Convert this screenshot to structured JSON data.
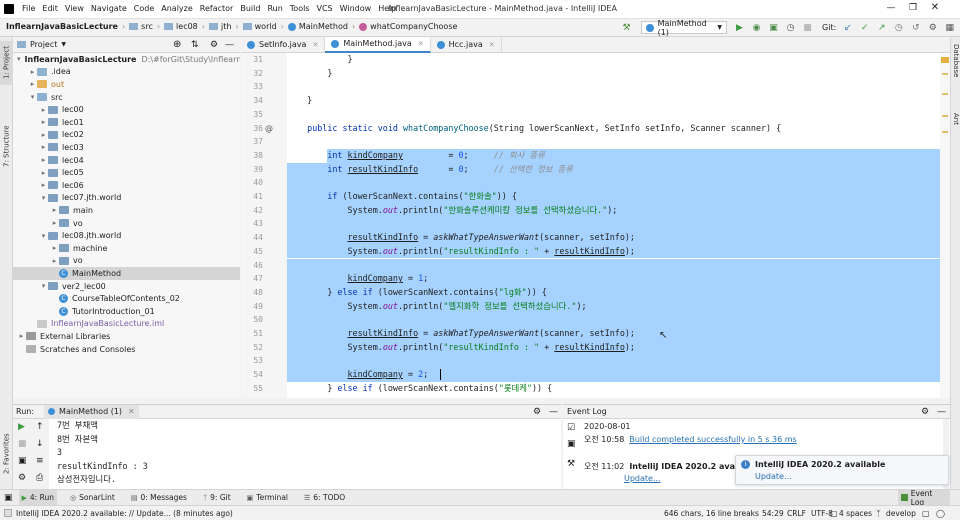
{
  "window": {
    "title": "InflearnJavaBasicLecture - MainMethod.java - IntelliJ IDEA",
    "menu": [
      "File",
      "Edit",
      "View",
      "Navigate",
      "Code",
      "Analyze",
      "Refactor",
      "Build",
      "Run",
      "Tools",
      "VCS",
      "Window",
      "Help"
    ]
  },
  "breadcrumb": [
    "InflearnJavaBasicLecture",
    "src",
    "lec08",
    "jth",
    "world",
    "MainMethod",
    "whatCompanyChoose"
  ],
  "toolbar": {
    "run_config": "MainMethod (1)",
    "git_label": "Git:"
  },
  "left_strip": {
    "project": "1: Project",
    "structure": "7: Structure",
    "favorites": "2: Favorites"
  },
  "right_strip": {
    "database": "Database",
    "ant": "Ant"
  },
  "project_panel": {
    "title": "Project",
    "tree": [
      {
        "label": "InflearnJavaBasicLecture",
        "path": "D:\\#forGit\\Study\\InflearnJavaBa",
        "depth": 0,
        "icon": "folder",
        "open": true,
        "bold": true
      },
      {
        "label": ".idea",
        "depth": 1,
        "icon": "folder",
        "open": false
      },
      {
        "label": "out",
        "depth": 1,
        "icon": "folder-orange",
        "open": false
      },
      {
        "label": "src",
        "depth": 1,
        "icon": "folder",
        "open": true
      },
      {
        "label": "lec00",
        "depth": 2,
        "icon": "package",
        "open": false
      },
      {
        "label": "lec01",
        "depth": 2,
        "icon": "package",
        "open": false
      },
      {
        "label": "lec02",
        "depth": 2,
        "icon": "package",
        "open": false
      },
      {
        "label": "lec03",
        "depth": 2,
        "icon": "package",
        "open": false
      },
      {
        "label": "lec04",
        "depth": 2,
        "icon": "package",
        "open": false
      },
      {
        "label": "lec05",
        "depth": 2,
        "icon": "package",
        "open": false
      },
      {
        "label": "lec06",
        "depth": 2,
        "icon": "package",
        "open": false
      },
      {
        "label": "lec07.jth.world",
        "depth": 2,
        "icon": "package",
        "open": true
      },
      {
        "label": "main",
        "depth": 3,
        "icon": "package",
        "open": false
      },
      {
        "label": "vo",
        "depth": 3,
        "icon": "package",
        "open": false
      },
      {
        "label": "lec08.jth.world",
        "depth": 2,
        "icon": "package",
        "open": true
      },
      {
        "label": "machine",
        "depth": 3,
        "icon": "package",
        "open": false
      },
      {
        "label": "vo",
        "depth": 3,
        "icon": "package",
        "open": false
      },
      {
        "label": "MainMethod",
        "depth": 3,
        "icon": "java",
        "leaf": true,
        "selected": true
      },
      {
        "label": "ver2_lec00",
        "depth": 2,
        "icon": "package",
        "open": true
      },
      {
        "label": "CourseTableOfContents_02",
        "depth": 3,
        "icon": "java",
        "leaf": true
      },
      {
        "label": "TutorIntroduction_01",
        "depth": 3,
        "icon": "java",
        "leaf": true
      },
      {
        "label": "InflearnJavaBasicLecture.iml",
        "depth": 1,
        "icon": "iml",
        "leaf": true
      },
      {
        "label": "External Libraries",
        "depth": 0,
        "icon": "lib",
        "open": false
      },
      {
        "label": "Scratches and Consoles",
        "depth": 0,
        "icon": "scratch",
        "leaf": true
      }
    ]
  },
  "editor": {
    "tabs": [
      {
        "label": "SetInfo.java",
        "active": false
      },
      {
        "label": "MainMethod.java",
        "active": true
      },
      {
        "label": "Hcc.java",
        "active": false
      }
    ],
    "lines": [
      {
        "n": "31",
        "sel": false,
        "html": "            }"
      },
      {
        "n": "32",
        "sel": false,
        "html": "        }"
      },
      {
        "n": "33",
        "sel": false,
        "html": ""
      },
      {
        "n": "34",
        "sel": false,
        "html": "    }"
      },
      {
        "n": "35",
        "sel": false,
        "html": ""
      },
      {
        "n": "36",
        "sel": false,
        "html": "    <span class=\"kw\">public static void</span> <span class=\"fn\">whatCompanyChoose</span>(String lowerScanNext, SetInfo setInfo, Scanner scanner) {"
      },
      {
        "n": "37",
        "sel": false,
        "html": ""
      },
      {
        "n": "38",
        "sel": "partial",
        "html": "        <span class=\"kw\">int</span> <span class=\"ul\">kindCompany</span>         = <span class=\"num\">0</span>;     <span class=\"cmt\">// 회사 종류</span>"
      },
      {
        "n": "39",
        "sel": true,
        "html": "        <span class=\"kw\">int</span> <span class=\"ul\">resultKindInfo</span>      = <span class=\"num\">0</span>;     <span class=\"cmt\">// 선택한 정보 종류</span>"
      },
      {
        "n": "40",
        "sel": true,
        "html": ""
      },
      {
        "n": "41",
        "sel": true,
        "html": "        <span class=\"kw\">if</span> (lowerScanNext.contains(<span class=\"str\">\"한화솔\"</span>)) {"
      },
      {
        "n": "42",
        "sel": true,
        "html": "            System.<span class=\"st\">out</span>.println(<span class=\"str\">\"한화솔루션케미칼 정보를 선택하셨습니다.\"</span>);"
      },
      {
        "n": "43",
        "sel": true,
        "html": ""
      },
      {
        "n": "44",
        "sel": true,
        "html": "            <span class=\"ul\">resultKindInfo</span> = <span class=\"mf\">askWhatTypeAnswerWant</span>(scanner, setInfo);"
      },
      {
        "n": "45",
        "sel": true,
        "html": "            System.<span class=\"st\">out</span>.println(<span class=\"str\">\"resultKindInfo : \"</span> + <span class=\"ul\">resultKindInfo</span>);"
      },
      {
        "n": "46",
        "sel": true,
        "html": ""
      },
      {
        "n": "47",
        "sel": true,
        "html": "            <span class=\"ul\">kindCompany</span> = <span class=\"num\">1</span>;"
      },
      {
        "n": "48",
        "sel": true,
        "html": "        } <span class=\"kw\">else if</span> (lowerScanNext.contains(<span class=\"str\">\"lg화\"</span>)) {"
      },
      {
        "n": "49",
        "sel": true,
        "html": "            System.<span class=\"st\">out</span>.println(<span class=\"str\">\"엘지화학 정보를 선택하셨습니다.\"</span>);"
      },
      {
        "n": "50",
        "sel": true,
        "html": ""
      },
      {
        "n": "51",
        "sel": true,
        "html": "            <span class=\"ul\">resultKindInfo</span> = <span class=\"mf\">askWhatTypeAnswerWant</span>(scanner, setInfo);"
      },
      {
        "n": "52",
        "sel": true,
        "html": "            System.<span class=\"st\">out</span>.println(<span class=\"str\">\"resultKindInfo : \"</span> + <span class=\"ul\">resultKindInfo</span>);"
      },
      {
        "n": "53",
        "sel": true,
        "html": ""
      },
      {
        "n": "54",
        "sel": true,
        "html": "            <span class=\"ul\">kindCompany</span> = <span class=\"num\">2</span>;"
      },
      {
        "n": "55",
        "sel": false,
        "html": "        } <span class=\"kw\">else if</span> (lowerScanNext.contains(<span class=\"str\">\"롯데케\"</span>)) {"
      }
    ]
  },
  "run_panel": {
    "label": "Run:",
    "tab": "MainMethod (1)",
    "console": [
      "7번 부채액",
      "8번 자본액",
      "3",
      "resultKindInfo : 3",
      "삼성전자입니다."
    ]
  },
  "event_log": {
    "title": "Event Log",
    "entries": [
      {
        "date": "2020-08-01"
      },
      {
        "time": "오전 10:58",
        "text": "Build completed successfully in 5 s 36 ms",
        "link": true
      },
      {
        "time": "오전 11:02",
        "text": "IntelliJ IDEA 2020.2 available",
        "bold": true,
        "action": "Update..."
      }
    ]
  },
  "notification": {
    "title": "IntelliJ IDEA 2020.2 available",
    "action": "Update..."
  },
  "bottom_tabs": [
    "4: Run",
    "SonarLint",
    "0: Messages",
    "9: Git",
    "Terminal",
    "6: TODO"
  ],
  "bottom_right_tab": "Event Log",
  "status": {
    "message": "IntelliJ IDEA 2020.2 available: // Update... (8 minutes ago)",
    "chars": "646 chars, 16 line breaks",
    "position": "54:29",
    "line_sep": "CRLF",
    "encoding": "UTF-8",
    "indent": "4 spaces",
    "branch": "develop"
  }
}
